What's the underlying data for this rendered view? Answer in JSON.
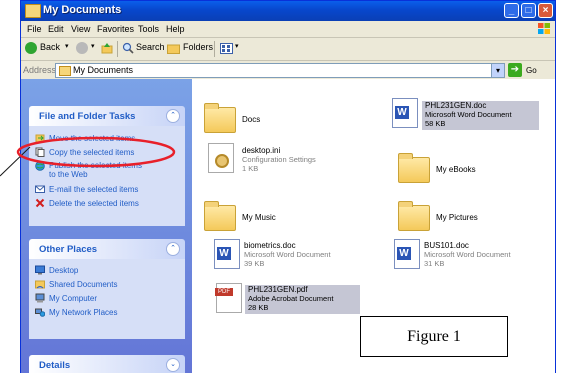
{
  "window": {
    "title": "My Documents"
  },
  "menu": [
    "File",
    "Edit",
    "View",
    "Favorites",
    "Tools",
    "Help"
  ],
  "toolbar": {
    "back": "Back",
    "search": "Search",
    "folders": "Folders"
  },
  "address": {
    "label": "Address",
    "value": "My Documents",
    "go": "Go"
  },
  "tasks_panel": {
    "title": "File and Folder Tasks",
    "items": [
      {
        "label": "Move the selected items",
        "icon": "move-icon"
      },
      {
        "label": "Copy the selected items",
        "icon": "copy-icon"
      },
      {
        "label": "Publish the selected items",
        "label2": "to the Web",
        "icon": "publish-web-icon"
      },
      {
        "label": "E-mail the selected items",
        "icon": "email-icon"
      },
      {
        "label": "Delete the selected items",
        "icon": "delete-icon"
      }
    ]
  },
  "places_panel": {
    "title": "Other Places",
    "items": [
      {
        "label": "Desktop",
        "icon": "desktop-icon"
      },
      {
        "label": "Shared Documents",
        "icon": "shared-folder-icon"
      },
      {
        "label": "My Computer",
        "icon": "computer-icon"
      },
      {
        "label": "My Network Places",
        "icon": "network-icon"
      }
    ]
  },
  "details_panel": {
    "title": "Details"
  },
  "files": [
    {
      "name": "Docs",
      "type": "folder"
    },
    {
      "name": "PHL231GEN.doc",
      "line2": "Microsoft Word Document",
      "line3": "58 KB",
      "type": "word",
      "selected": true
    },
    {
      "name": "desktop.ini",
      "line2": "Configuration Settings",
      "line3": "1 KB",
      "type": "ini"
    },
    {
      "name": "My eBooks",
      "type": "folder"
    },
    {
      "name": "My Music",
      "type": "folder"
    },
    {
      "name": "My Pictures",
      "type": "folder"
    },
    {
      "name": "biometrics.doc",
      "line2": "Microsoft Word Document",
      "line3": "39 KB",
      "type": "word"
    },
    {
      "name": "BUS101.doc",
      "line2": "Microsoft Word Document",
      "line3": "31 KB",
      "type": "word"
    },
    {
      "name": "PHL231GEN.pdf",
      "line2": "Adobe Acrobat Document",
      "line3": "28 KB",
      "type": "pdf",
      "selected": true,
      "pdf_label": "PDF"
    }
  ],
  "figure_label": "Figure 1",
  "colors": {
    "title_bar": "#0A5FEB",
    "link_blue": "#215DC6",
    "highlight": "#E8202A",
    "selection": "#C5C6D4"
  }
}
